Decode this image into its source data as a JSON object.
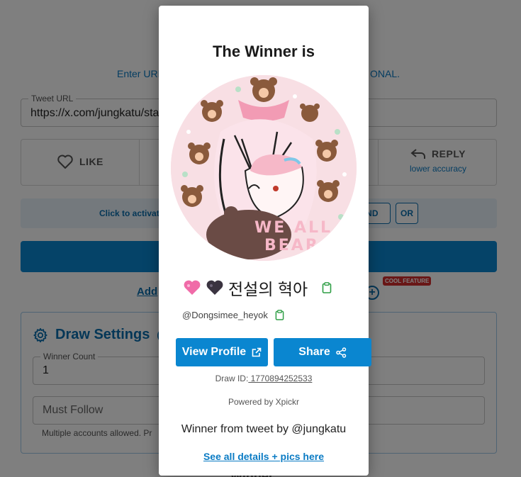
{
  "background": {
    "subtitle_left": "Enter URL",
    "subtitle_right": "ONAL.",
    "tweet_url": {
      "label": "Tweet URL",
      "value": "https://x.com/jungkatu/status"
    },
    "like_label": "LIKE",
    "reply": {
      "label": "REPLY",
      "sub": "lower accuracy"
    },
    "strip_text": "Click to activate",
    "chip_and": "AND",
    "chip_or": "OR",
    "add_link": "Add",
    "cool_badge": "COOL FEATURE",
    "settings": {
      "title": "Draw Settings",
      "title_paren": "(C",
      "winner_count": {
        "label": "Winner Count",
        "value": "1"
      },
      "must_follow_placeholder": "Must Follow",
      "hint": "Multiple accounts allowed. Pr"
    },
    "bottom_text": "Winner"
  },
  "modal": {
    "title": "The Winner is",
    "display_name": "전설의 혁아",
    "handle": "@Dongsimee_heyok",
    "view_profile_label": "View Profile",
    "share_label": "Share",
    "draw_id_label": "Draw ID:",
    "draw_id_value": " 1770894252533",
    "powered_by": "Powered by Xpickr",
    "from_tweet": "Winner from tweet by @jungkatu",
    "see_all": "See all details + pics here",
    "avatar_text_line1": "WE ALL",
    "avatar_text_line2": "BEAR"
  },
  "colors": {
    "accent": "#0a86d0",
    "link": "#0a7bc4",
    "copy_icon": "#2e9e45",
    "overlay": "rgba(0,0,0,0.5)",
    "cool_badge": "#d32f2f"
  },
  "icons": [
    "heart-outline-icon",
    "reply-arrow-icon",
    "gear-icon",
    "plus-circle-icon",
    "pink-heart-emoji",
    "black-heart-emoji",
    "clipboard-icon",
    "external-link-icon",
    "share-icon"
  ]
}
